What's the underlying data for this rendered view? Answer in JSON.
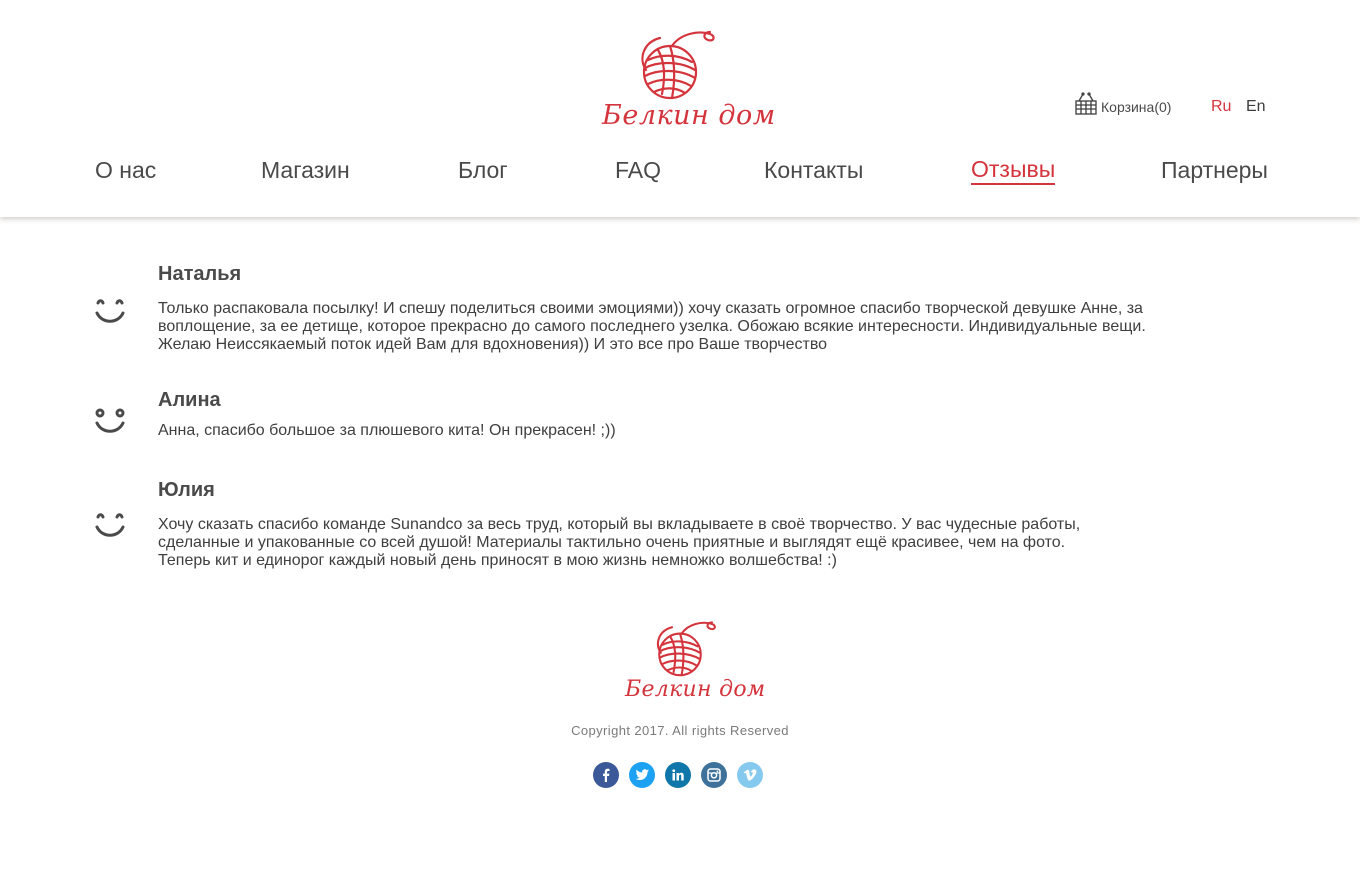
{
  "brand": {
    "logo_text": "Белкин дом",
    "accent_color": "#d4343c"
  },
  "header": {
    "cart_label": "Корзина(0)",
    "lang_ru": "Ru",
    "lang_en": "En"
  },
  "nav": {
    "items": [
      {
        "label": "О нас"
      },
      {
        "label": "Магазин"
      },
      {
        "label": "Блог"
      },
      {
        "label": "FAQ"
      },
      {
        "label": "Контакты"
      },
      {
        "label": "Отзывы",
        "active": true
      },
      {
        "label": "Партнеры"
      }
    ]
  },
  "reviews": [
    {
      "name": "Наталья",
      "text": "Только распаковала посылку! И спешу поделиться своими эмоциями)) хочу сказать огромное спасибо творческой девушке Анне, за воплощение, за ее детище, которое прекрасно до самого последнего узелка. Обожаю всякие интересности. Индивидуальные вещи. Желаю Неиссякаемый поток идей Вам для вдохновения)) И это все про Ваше творчество",
      "icon": "smile-closed-eyes-icon"
    },
    {
      "name": "Алина",
      "text": "Анна, спасибо большое за плюшевого кита! Он прекрасен! ;))",
      "icon": "smile-open-eyes-icon"
    },
    {
      "name": "Юлия",
      "text": "Хочу сказать спасибо команде Sunandco за весь труд, который вы вкладываете в своё творчество. У вас чудесные работы, сделанные и упакованные со всей душой! Материалы тактильно очень приятные и выглядят ещё красивее, чем на фото. Теперь кит и единорог каждый новый день приносят в мою жизнь немножко волшебства! :)",
      "icon": "smile-closed-eyes-icon"
    }
  ],
  "footer": {
    "copyright": "Copyright 2017. All rights Reserved",
    "socials": [
      {
        "name": "facebook-icon",
        "color": "#3b5998"
      },
      {
        "name": "twitter-icon",
        "color": "#1da1f2"
      },
      {
        "name": "linkedin-icon",
        "color": "#0e76a8"
      },
      {
        "name": "instagram-icon",
        "color": "#3f729b"
      },
      {
        "name": "vimeo-icon",
        "color": "#86c9ef"
      }
    ]
  }
}
